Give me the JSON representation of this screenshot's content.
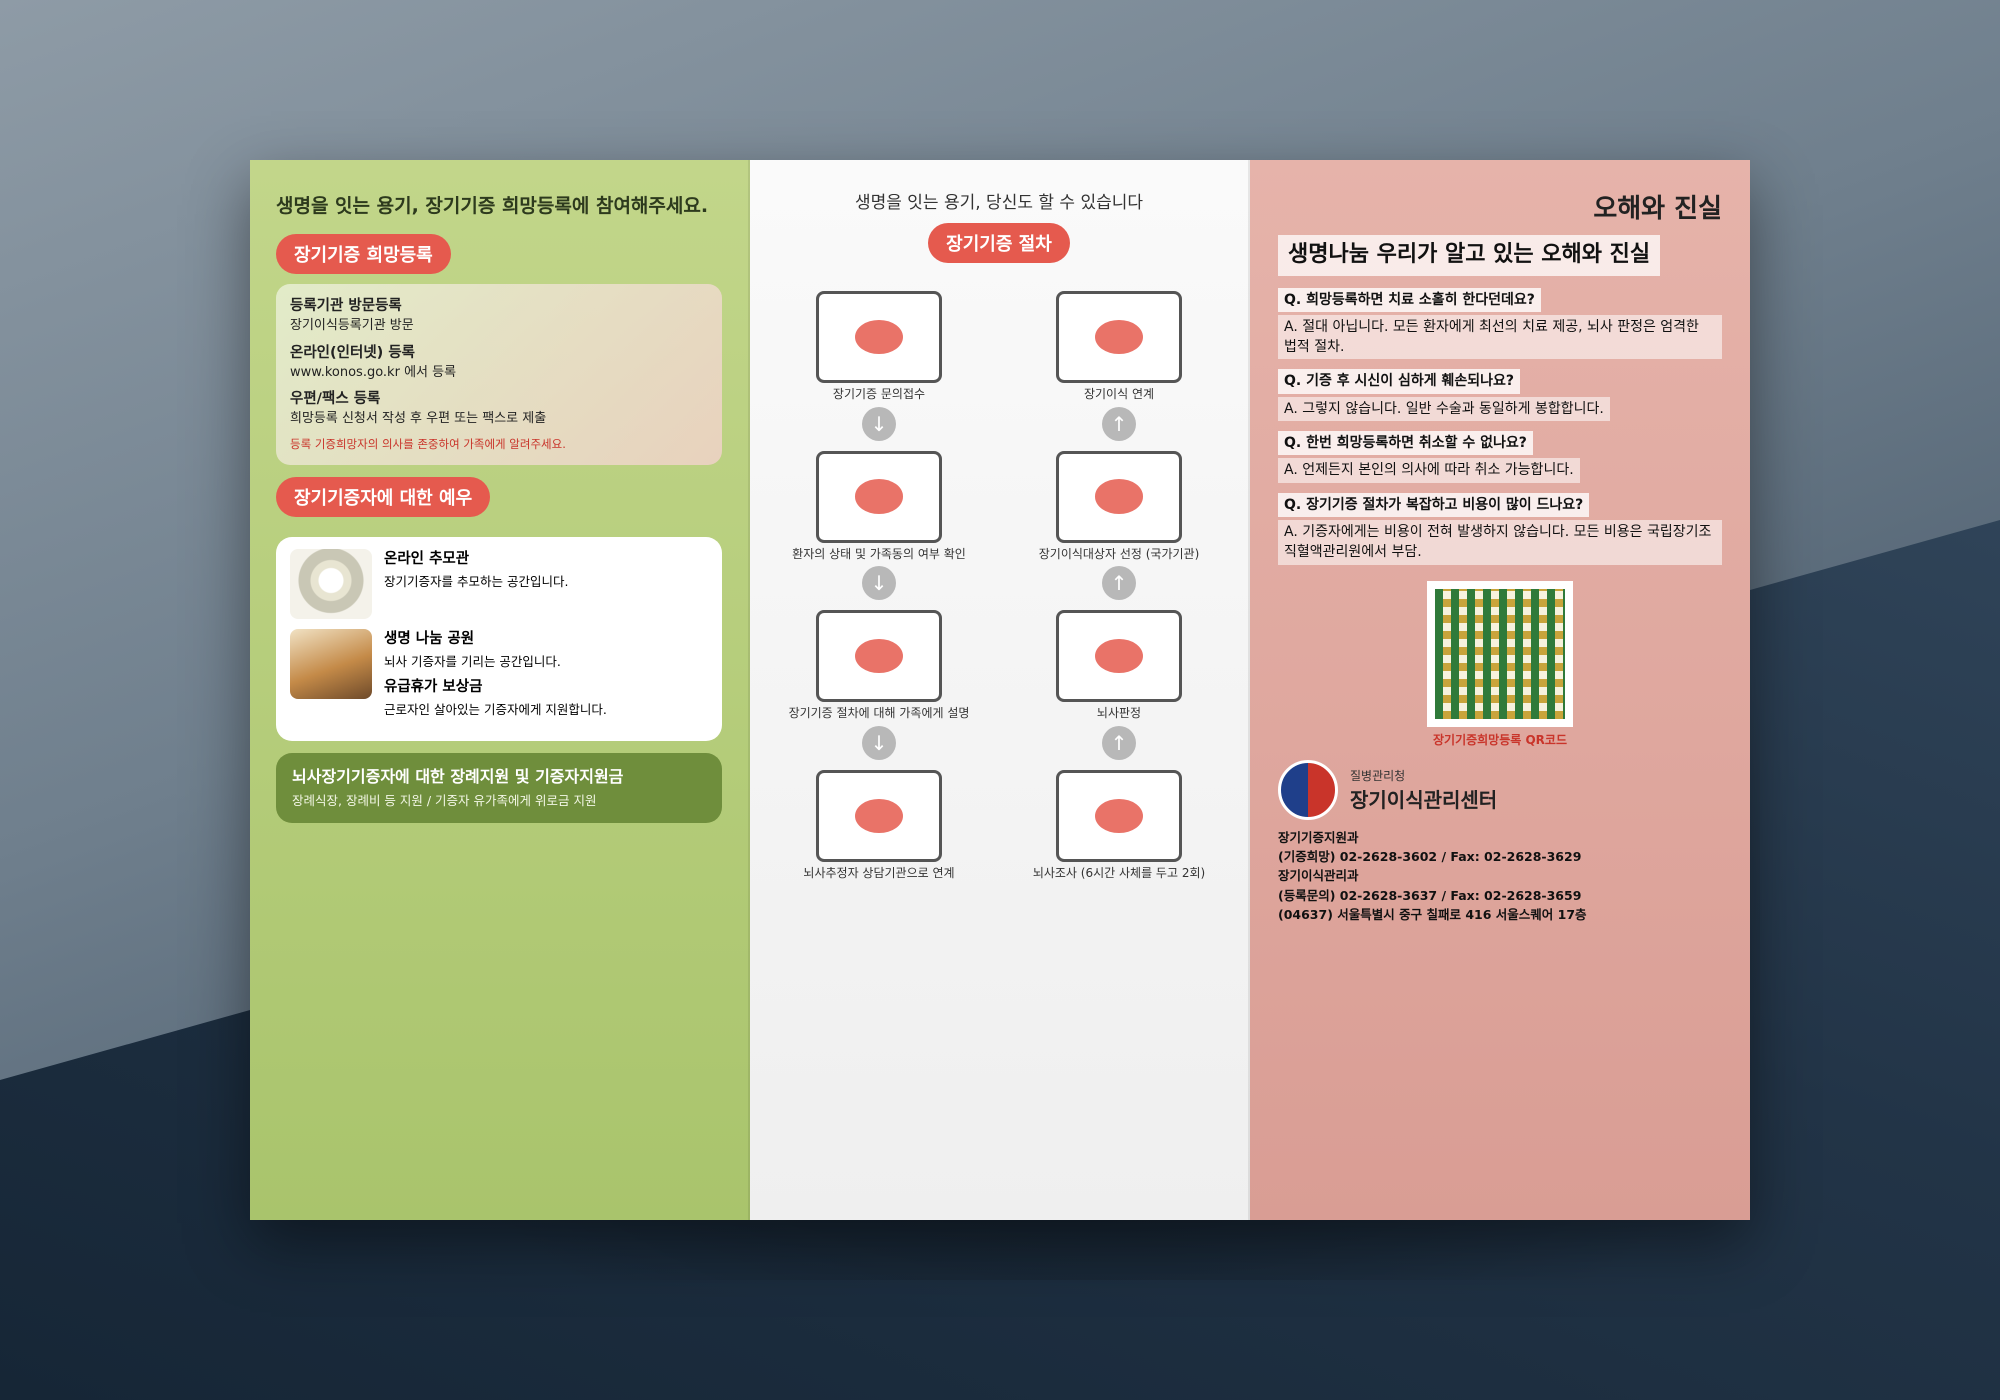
{
  "left_panel": {
    "tagline": "생명을 잇는 용기, 장기기증 희망등록에 참여해주세요.",
    "pill": "장기기증 희망등록",
    "register_items": [
      {
        "title": "등록기관 방문등록",
        "text": "장기이식등록기관 방문"
      },
      {
        "title": "온라인(인터넷) 등록",
        "text": "www.konos.go.kr 에서 등록"
      },
      {
        "title": "우편/팩스 등록",
        "text": "희망등록 신청서 작성 후 우편 또는 팩스로 제출"
      }
    ],
    "register_note": "등록 기증희망자의 의사를 존중하여 가족에게 알려주세요.",
    "respect_pill": "장기기증자에 대한 예우",
    "respect_items": [
      {
        "title": "온라인 추모관",
        "text": "장기기증자를 추모하는 공간입니다."
      },
      {
        "title": "생명 나눔 공원",
        "text": "뇌사 기증자를 기리는 공간입니다."
      },
      {
        "title": "유급휴가 보상금",
        "text": "근로자인 살아있는 기증자에게 지원합니다."
      }
    ],
    "dark_box": {
      "title": "뇌사장기기증자에 대한 장례지원 및 기증자지원금",
      "text": "장례식장, 장례비 등 지원 / 기증자 유가족에게 위로금 지원"
    }
  },
  "mid_panel": {
    "tagline": "생명을 잇는 용기, 당신도 할 수 있습니다",
    "pill": "장기기증 절차",
    "steps": [
      {
        "label": "장기기증 문의접수"
      },
      {
        "label": "장기이식 연계"
      },
      {
        "label": "환자의 상태 및 가족동의 여부 확인"
      },
      {
        "label": "장기이식대상자 선정 (국가기관)"
      },
      {
        "label": "장기기증 절차에 대해 가족에게 설명"
      },
      {
        "label": "뇌사판정"
      },
      {
        "label": "뇌사추정자 상담기관으로 연계"
      },
      {
        "label": "뇌사조사 (6시간 사체를 두고 2회)"
      }
    ]
  },
  "right_panel": {
    "title": "오해와 진실",
    "heading": "생명나눔 우리가 알고 있는 오해와 진실",
    "qa": [
      {
        "q": "Q. 희망등록하면 치료 소홀히 한다던데요?",
        "a": "A. 절대 아닙니다. 모든 환자에게 최선의 치료 제공, 뇌사 판정은 엄격한 법적 절차."
      },
      {
        "q": "Q. 기증 후 시신이 심하게 훼손되나요?",
        "a": "A. 그렇지 않습니다. 일반 수술과 동일하게 봉합합니다."
      },
      {
        "q": "Q. 한번 희망등록하면 취소할 수 없나요?",
        "a": "A. 언제든지 본인의 의사에 따라 취소 가능합니다."
      },
      {
        "q": "Q. 장기기증 절차가 복잡하고 비용이 많이 드나요?",
        "a": "A. 기증자에게는 비용이 전혀 발생하지 않습니다. 모든 비용은 국립장기조직혈액관리원에서 부담."
      }
    ],
    "qr_label": "장기기증희망등록 QR코드",
    "agency_small": "질병관리청",
    "agency_big": "장기이식관리센터",
    "contacts": [
      "장기기증지원과",
      "(기증희망) 02-2628-3602 / Fax: 02-2628-3629",
      "장기이식관리과",
      "(등록문의) 02-2628-3637 / Fax: 02-2628-3659",
      "(04637) 서울특별시 중구 칠패로 416 서울스퀘어 17층"
    ]
  }
}
